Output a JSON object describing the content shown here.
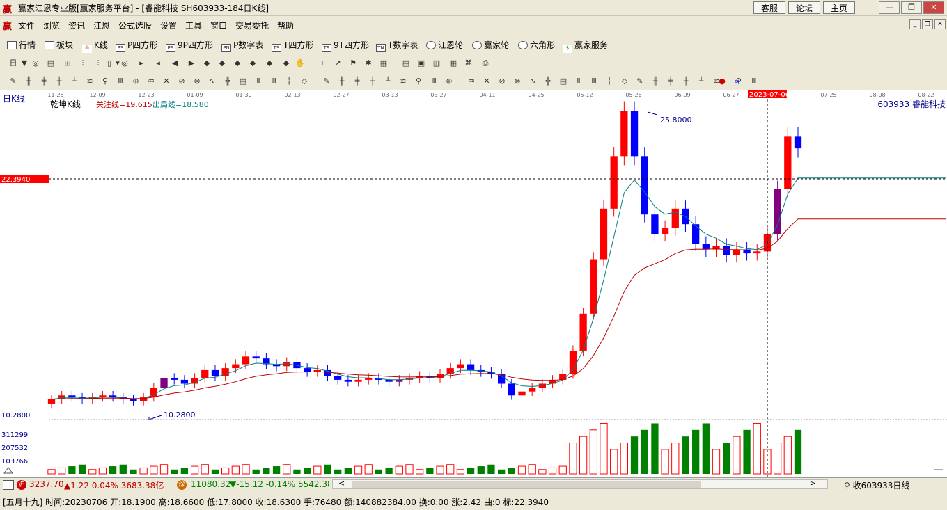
{
  "window": {
    "logo": "赢",
    "title": "赢家江恩专业版[赢家服务平台] - [睿能科技  SH603933-184日K线]",
    "top_buttons": [
      "客服",
      "论坛",
      "主页"
    ]
  },
  "menu": {
    "items": [
      "文件",
      "浏览",
      "资讯",
      "江恩",
      "公式选股",
      "设置",
      "工具",
      "窗口",
      "交易委托",
      "帮助"
    ]
  },
  "toolbar1": {
    "items": [
      {
        "icon": "grid-icon",
        "label": "行情"
      },
      {
        "icon": "blocks-icon",
        "label": "板块"
      },
      {
        "icon": "candle-icon",
        "label": "K线"
      },
      {
        "icon": "ps-icon",
        "label": "P四方形"
      },
      {
        "icon": "p9-icon",
        "label": "9P四方形"
      },
      {
        "icon": "pn-icon",
        "label": "P数字表"
      },
      {
        "icon": "ts-icon",
        "label": "T四方形"
      },
      {
        "icon": "t9-icon",
        "label": "9T四方形"
      },
      {
        "icon": "tn-icon",
        "label": "T数字表"
      },
      {
        "icon": "wheel-icon",
        "label": "江恩轮"
      },
      {
        "icon": "wheel2-icon",
        "label": "赢家轮"
      },
      {
        "icon": "hexagon-icon",
        "label": "六角形"
      },
      {
        "icon": "dollar-icon",
        "label": "赢家服务"
      }
    ]
  },
  "chart": {
    "period_label": "日K线",
    "indicator_name": "乾坤K线",
    "attention_line": "关注线=19.615",
    "exit_line": "出局线=18.580",
    "stock": "603933  睿能科技",
    "crosshair_price": "22.3940",
    "crosshair_date": "2023-07-06",
    "high_label": "25.8000",
    "low_label": "10.2800",
    "low_axis_label": "10.2800",
    "volume_axis_labels": [
      "311299",
      "207532",
      "103766"
    ],
    "date_ticks": [
      "11-25",
      "12-09",
      "12-23",
      "01-09",
      "01-30",
      "02-13",
      "02-27",
      "03-13",
      "03-27",
      "04-11",
      "04-25",
      "05-12",
      "05-26",
      "06-09",
      "06-27",
      "2023-07-06",
      "07-25",
      "08-08",
      "08-22"
    ]
  },
  "chart_data": {
    "type": "candlestick",
    "y_range": [
      10.28,
      25.8
    ],
    "period": "daily",
    "ohlc_closes_approx": [
      11.0,
      11.2,
      11.1,
      11.0,
      11.1,
      11.2,
      11.1,
      11.0,
      10.9,
      11.1,
      11.6,
      12.1,
      12.0,
      11.8,
      12.1,
      12.5,
      12.2,
      12.6,
      12.8,
      13.2,
      13.1,
      12.8,
      12.7,
      12.9,
      12.6,
      12.4,
      12.5,
      12.2,
      12.0,
      11.9,
      12.0,
      12.1,
      12.0,
      11.9,
      12.0,
      12.1,
      12.2,
      12.1,
      12.3,
      12.6,
      12.8,
      12.5,
      12.4,
      12.3,
      11.8,
      11.2,
      11.4,
      11.6,
      11.8,
      12.0,
      12.3,
      13.5,
      15.4,
      18.2,
      20.8,
      23.5,
      25.8,
      23.5,
      20.5,
      19.5,
      19.8,
      20.8,
      20.0,
      19.0,
      18.7,
      18.9,
      18.4,
      18.7,
      18.5,
      18.6,
      19.5,
      21.8,
      24.5,
      23.9
    ],
    "series": [
      {
        "name": "关注线",
        "last_value": 19.615
      },
      {
        "name": "出局线",
        "last_value": 18.58
      }
    ],
    "volume_max": 311299
  },
  "status": {
    "sh_index": "3237.70",
    "sh_change": "▲1.22 0.04% 3683.38亿",
    "sz_index": "11080.32",
    "sz_change": "▼-15.12 -0.14% 5542.38",
    "sz_badge": "深",
    "sh_badge": "沪",
    "right_label": "收603933日线"
  },
  "info": {
    "text": "[五月十九] 时间:20230706 开:18.1900 高:18.6600 低:17.8000 收:18.6300 手:76480 额:140882384.00 换:0.00 涨:2.42 曲:0 标:22.3940"
  },
  "colors": {
    "up": "#ff0000",
    "down": "#0000ff",
    "purple": "#800080",
    "ma_fast": "#008080",
    "ma_slow": "#c00000",
    "volume_green": "#008000"
  }
}
